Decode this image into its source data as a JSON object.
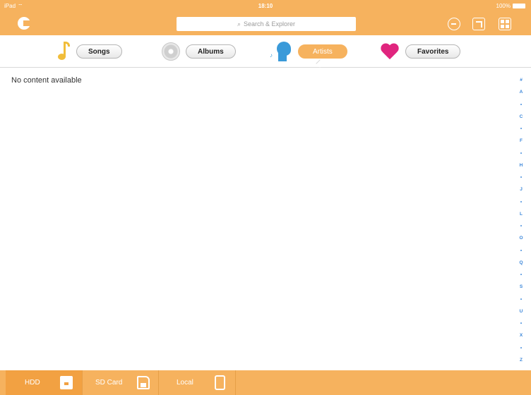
{
  "status": {
    "carrier": "iPad",
    "time": "18:10",
    "battery": "100%"
  },
  "header": {
    "search_placeholder": "Search & Explorer"
  },
  "tabs": [
    {
      "label": "Songs",
      "icon": "music-note-icon",
      "active": false
    },
    {
      "label": "Albums",
      "icon": "disc-icon",
      "active": false
    },
    {
      "label": "Artists",
      "icon": "artist-icon",
      "active": true
    },
    {
      "label": "Favorites",
      "icon": "heart-icon",
      "active": false
    }
  ],
  "content": {
    "empty_message": "No content available"
  },
  "index": [
    "#",
    "A",
    "•",
    "C",
    "•",
    "F",
    "•",
    "H",
    "•",
    "J",
    "•",
    "L",
    "•",
    "O",
    "•",
    "Q",
    "•",
    "S",
    "•",
    "U",
    "•",
    "X",
    "•",
    "Z"
  ],
  "bottom_tabs": [
    {
      "label": "HDD",
      "icon": "hdd-icon",
      "active": true
    },
    {
      "label": "SD Card",
      "icon": "sd-card-icon",
      "active": false
    },
    {
      "label": "Local",
      "icon": "tablet-icon",
      "active": false
    }
  ],
  "colors": {
    "accent": "#f6b25e",
    "index_link": "#3a86d9",
    "favorites": "#e0257e",
    "artist": "#3a9ad9"
  }
}
